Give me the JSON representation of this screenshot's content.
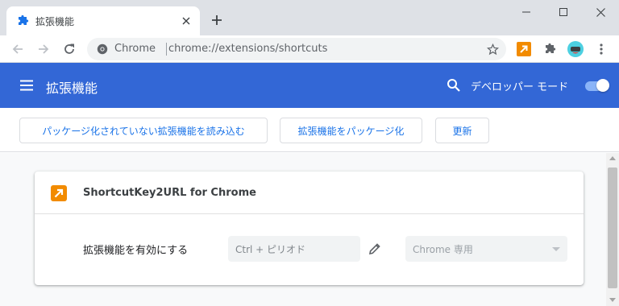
{
  "tab": {
    "title": "拡張機能"
  },
  "omnibox": {
    "chip": "Chrome",
    "url": "chrome://extensions/shortcuts"
  },
  "header": {
    "title": "拡張機能",
    "dev_mode_label": "デベロッパー モード",
    "dev_mode_on": true
  },
  "actions": {
    "load_unpacked": "パッケージ化されていない拡張機能を読み込む",
    "pack": "拡張機能をパッケージ化",
    "update": "更新"
  },
  "extension": {
    "name": "ShortcutKey2URL for Chrome",
    "command_label": "拡張機能を有効にする",
    "shortcut_placeholder": "Ctrl + ピリオド",
    "scope_value": "Chrome 専用"
  },
  "colors": {
    "header": "#3367d6",
    "accent": "#1a73e8",
    "ext_icon": "#f28b00"
  },
  "icons": {
    "tab_favicon": "puzzle-icon",
    "new_tab": "plus-icon",
    "back": "back-arrow-icon",
    "forward": "forward-arrow-icon",
    "reload": "reload-icon",
    "bookmark": "star-icon",
    "menu": "hamburger-icon",
    "search": "search-icon",
    "edit": "pencil-icon"
  }
}
